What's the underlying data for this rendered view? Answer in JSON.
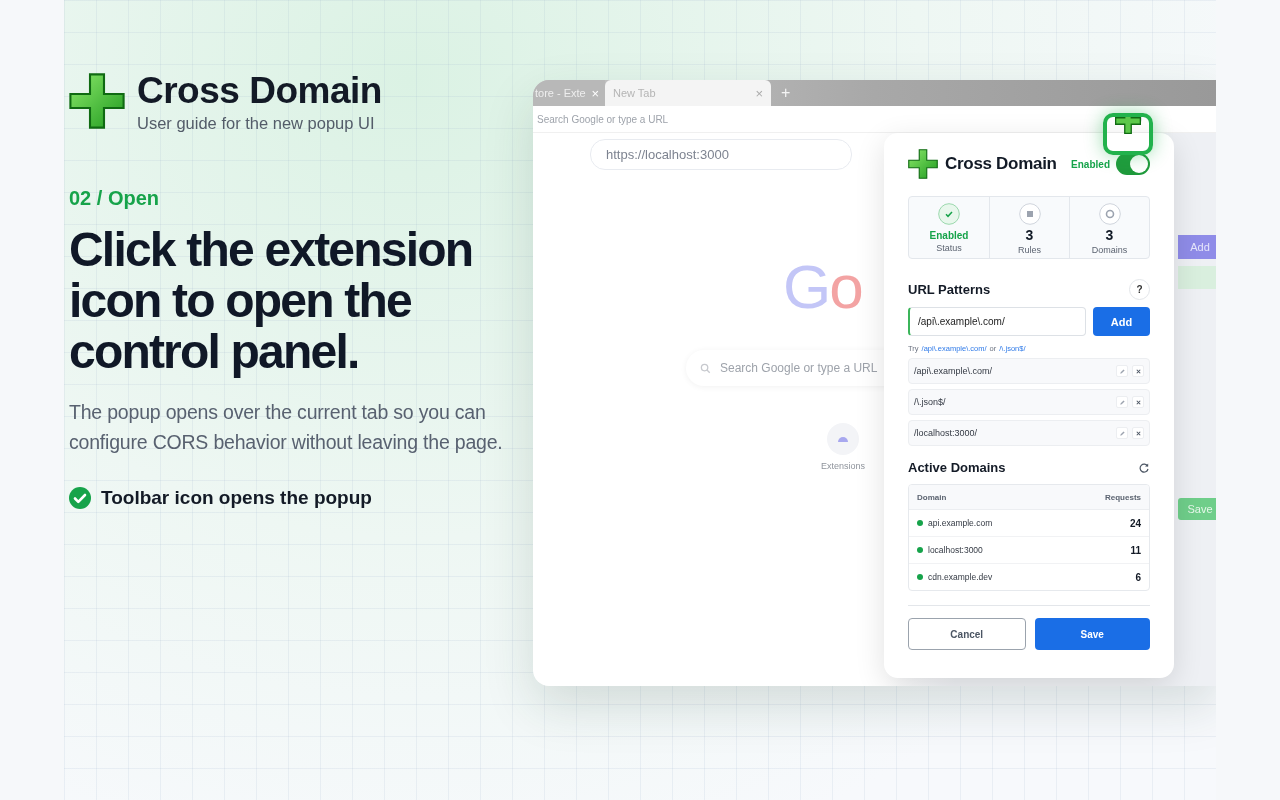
{
  "brand": {
    "title": "Cross Domain",
    "subtitle": "User guide for the new popup UI"
  },
  "step": "02 / Open",
  "headline": "Click the extension icon to open the control panel.",
  "description": "The popup opens over the current tab so you can configure CORS behavior without leaving the page.",
  "bullets": [
    {
      "text": "Toolbar icon opens the popup",
      "checked": true
    }
  ],
  "browser": {
    "tabs": [
      {
        "label": "tore - Exte",
        "close": "×",
        "selected": false
      },
      {
        "label": "New Tab",
        "close": "×",
        "selected": true
      }
    ],
    "new_tab": "+",
    "omnibox_placeholder": "Search Google or type a URL",
    "page_url": "https://localhost:3000",
    "logo": "Go",
    "search_placeholder": "Search Google or type a URL",
    "shortcut": "Extensions",
    "behind_add": "Add",
    "behind_save": "Save"
  },
  "popup": {
    "title": "Cross Domain",
    "toggle": {
      "label": "Enabled",
      "on": true
    },
    "stats": [
      {
        "kind": "status",
        "value": "Enabled",
        "label": "Status"
      },
      {
        "kind": "rules",
        "value": "3",
        "label": "Rules"
      },
      {
        "kind": "domains",
        "value": "3",
        "label": "Domains"
      }
    ],
    "patterns_title": "URL Patterns",
    "help": "?",
    "input_value": "/api\\.example\\.com/",
    "add": "Add",
    "hint": {
      "prefix": "Try",
      "examples": [
        "/api\\.example\\.com/",
        "/\\.json$/"
      ],
      "joiner": "or"
    },
    "patterns": [
      "/api\\.example\\.com/",
      "/\\.json$/",
      "/localhost:3000/"
    ],
    "domains_title": "Active Domains",
    "columns": [
      "Domain",
      "Requests"
    ],
    "domains": [
      {
        "name": "api.example.com",
        "requests": "24",
        "color": "#16a34a"
      },
      {
        "name": "localhost:3000",
        "requests": "11",
        "color": "#16a34a"
      },
      {
        "name": "cdn.example.dev",
        "requests": "6",
        "color": "#16a34a"
      }
    ],
    "cancel": "Cancel",
    "save": "Save"
  }
}
